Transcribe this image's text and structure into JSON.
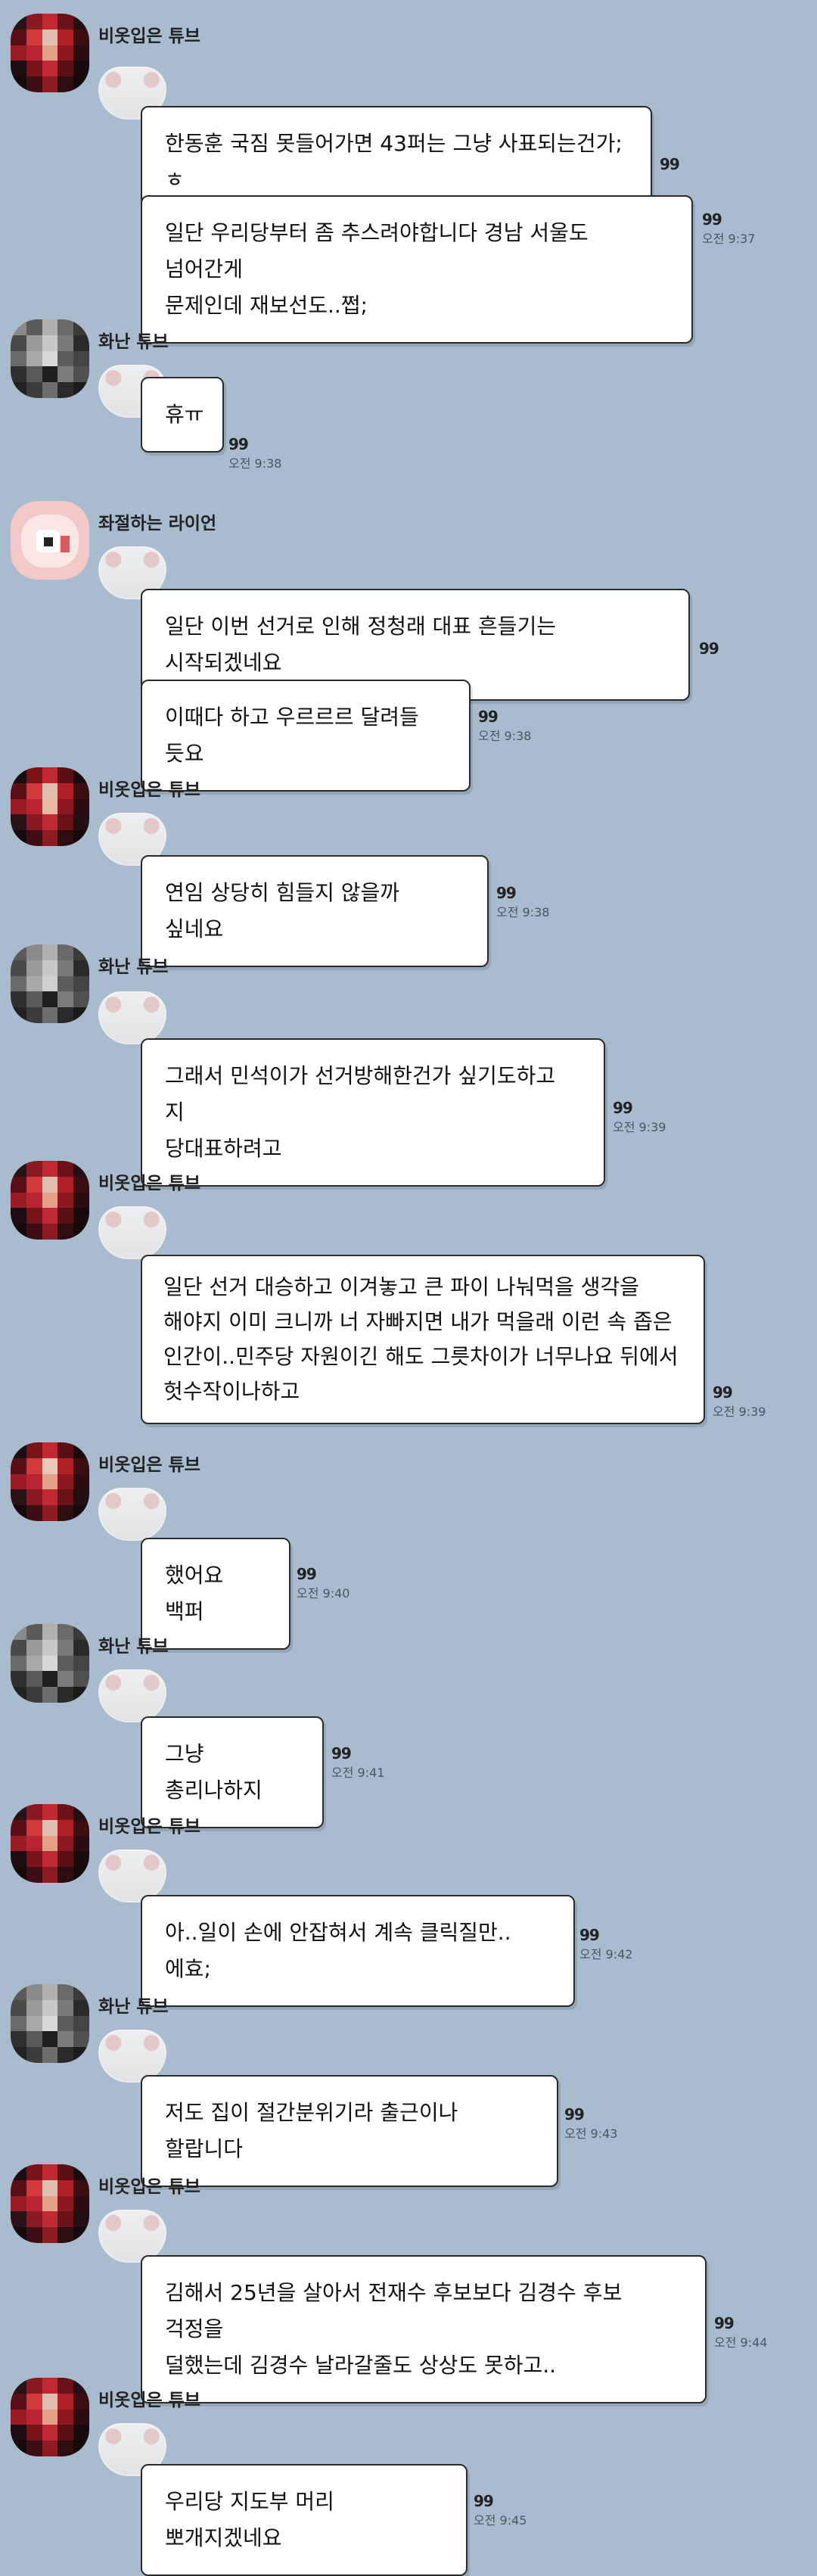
{
  "chat": {
    "messages": [
      {
        "sender": "비옷입은 튜브",
        "avatar": "red",
        "lines": [
          "한동훈 국짐 못들어가면 43퍼는 그냥 사표되는건가;ㅎ"
        ],
        "count": "99",
        "time": ""
      },
      {
        "sender": "",
        "avatar": "",
        "lines": [
          "일단 우리당부터 좀 추스려야합니다 경남 서울도 넘어간게",
          "문제인데 재보선도..쩝;"
        ],
        "count": "99",
        "time": "오전 9:37"
      },
      {
        "sender": "화난 튜브",
        "avatar": "gray",
        "lines": [
          "휴ㅠ"
        ],
        "count": "99",
        "time": "오전 9:38"
      },
      {
        "sender": "좌절하는 라이언",
        "avatar": "pink",
        "lines": [
          "일단 이번 선거로 인해 정청래 대표 흔들기는 시작되겠네요"
        ],
        "count": "99",
        "time": ""
      },
      {
        "sender": "",
        "avatar": "",
        "lines": [
          "이때다 하고 우르르르 달려들 듯요"
        ],
        "count": "99",
        "time": "오전 9:38"
      },
      {
        "sender": "비옷입은 튜브",
        "avatar": "red",
        "lines": [
          "연임 상당히 힘들지 않을까 싶네요"
        ],
        "count": "99",
        "time": "오전 9:38"
      },
      {
        "sender": "화난 튜브",
        "avatar": "gray",
        "lines": [
          "그래서 민석이가 선거방해한건가 싶기도하고 지",
          "당대표하려고"
        ],
        "count": "99",
        "time": "오전 9:39"
      },
      {
        "sender": "비옷입은 튜브",
        "avatar": "red",
        "lines": [
          "일단 선거 대승하고 이겨놓고 큰 파이 나눠먹을 생각을",
          "해야지 이미 크니까 너 자빠지면 내가 먹을래 이런 속 좁은",
          "인간이..민주당 자원이긴 해도 그릇차이가 너무나요 뒤에서",
          "헛수작이나하고"
        ],
        "count": "99",
        "time": "오전 9:39"
      },
      {
        "sender": "비옷입은 튜브",
        "avatar": "red",
        "lines": [
          "했어요 백퍼"
        ],
        "count": "99",
        "time": "오전 9:40"
      },
      {
        "sender": "화난 튜브",
        "avatar": "gray",
        "lines": [
          "그냥 총리나하지"
        ],
        "count": "99",
        "time": "오전 9:41"
      },
      {
        "sender": "비옷입은 튜브",
        "avatar": "red",
        "lines": [
          "아..일이 손에 안잡혀서 계속 클릭질만..에효;"
        ],
        "count": "99",
        "time": "오전 9:42"
      },
      {
        "sender": "화난 튜브",
        "avatar": "gray",
        "lines": [
          "저도 집이 절간분위기라 출근이나 할랍니다"
        ],
        "count": "99",
        "time": "오전 9:43"
      },
      {
        "sender": "비옷입은 튜브",
        "avatar": "red",
        "lines": [
          "김해서 25년을 살아서 전재수 후보보다 김경수 후보 걱정을",
          "덜했는데 김경수 날라갈줄도 상상도 못하고.."
        ],
        "count": "99",
        "time": "오전 9:44"
      },
      {
        "sender": "비옷입은 튜브",
        "avatar": "red",
        "lines": [
          "우리당 지도부 머리 뽀개지겠네요"
        ],
        "count": "99",
        "time": "오전 9:45"
      }
    ]
  },
  "colors": {
    "background": "#a9bccf",
    "bubble": "#ffffff",
    "bubble_border": "#2a2a2a"
  },
  "icons": {
    "avatar_placeholder": "mosaic-avatar",
    "sticker": "pixelated-emoticon"
  }
}
